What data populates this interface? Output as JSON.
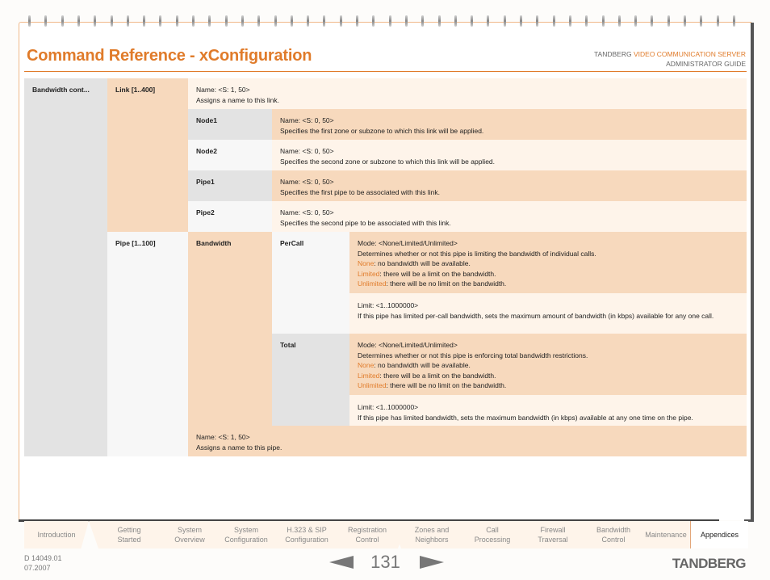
{
  "header": {
    "title": "Command Reference - xConfiguration",
    "brand": "TANDBERG",
    "product": "VIDEO COMMUNICATION SERVER",
    "guide": "ADMINISTRATOR GUIDE"
  },
  "colors": {
    "accent": "#e07b2a",
    "peach": "#f7d9bd",
    "cream": "#fef4ea",
    "gray": "#e3e3e3",
    "light": "#f7f7f7"
  },
  "table": {
    "section": "Bandwidth cont...",
    "link": {
      "label": "Link [1..400]",
      "name_head": "Name: <S: 1, 50>",
      "name_desc": "Assigns a name to this link.",
      "rows": [
        {
          "label": "Node1",
          "head": "Name: <S: 0, 50>",
          "desc": "Specifies the first zone or subzone to which this link will be applied."
        },
        {
          "label": "Node2",
          "head": "Name: <S: 0, 50>",
          "desc": "Specifies the second zone or subzone to which this link will be applied."
        },
        {
          "label": "Pipe1",
          "head": "Name: <S: 0, 50>",
          "desc": "Specifies the first pipe to be associated with this link."
        },
        {
          "label": "Pipe2",
          "head": "Name: <S: 0, 50>",
          "desc": "Specifies the second pipe to be associated with this link."
        }
      ]
    },
    "pipe": {
      "label": "Pipe [1..100]",
      "bandwidth_label": "Bandwidth",
      "percall": {
        "label": "PerCall",
        "mode_head": "Mode: <None/Limited/Unlimited>",
        "mode_desc": "Determines whether or not this pipe is limiting the bandwidth of individual calls.",
        "options": [
          {
            "name": "None",
            "desc": ": no bandwidth will be available."
          },
          {
            "name": "Limited",
            "desc": ": there will be a limit on the bandwidth."
          },
          {
            "name": "Unlimited",
            "desc": ": there will be no limit on the bandwidth."
          }
        ],
        "limit_head": "Limit: <1..1000000>",
        "limit_desc": "If this pipe has limited per-call bandwidth, sets the maximum amount of bandwidth (in kbps) available for any one call."
      },
      "total": {
        "label": "Total",
        "mode_head": "Mode: <None/Limited/Unlimited>",
        "mode_desc": "Determines whether or not this pipe is enforcing total bandwidth restrictions.",
        "options": [
          {
            "name": "None",
            "desc": ": no bandwidth will be available."
          },
          {
            "name": "Limited",
            "desc": ": there will be a limit on the bandwidth."
          },
          {
            "name": "Unlimited",
            "desc": ": there will be no limit on the bandwidth."
          }
        ],
        "limit_head": "Limit: <1..1000000>",
        "limit_desc": "If this pipe has limited bandwidth, sets the maximum bandwidth (in kbps) available at any one time on the pipe."
      },
      "name_head": "Name: <S: 1, 50>",
      "name_desc": "Assigns a name to this pipe."
    }
  },
  "tabs": [
    {
      "line1": "Introduction",
      "line2": ""
    },
    {
      "line1": "Getting",
      "line2": "Started"
    },
    {
      "line1": "System",
      "line2": "Overview"
    },
    {
      "line1": "System",
      "line2": "Configuration"
    },
    {
      "line1": "H.323 & SIP",
      "line2": "Configuration"
    },
    {
      "line1": "Registration",
      "line2": "Control"
    },
    {
      "line1": "Zones and",
      "line2": "Neighbors"
    },
    {
      "line1": "Call",
      "line2": "Processing"
    },
    {
      "line1": "Firewall",
      "line2": "Traversal"
    },
    {
      "line1": "Bandwidth",
      "line2": "Control"
    },
    {
      "line1": "Maintenance",
      "line2": ""
    },
    {
      "line1": "Appendices",
      "line2": "",
      "active": true
    }
  ],
  "footer": {
    "doc_id": "D 14049.01",
    "date": "07.2007",
    "page_number": "131",
    "logo": "TANDBERG"
  }
}
